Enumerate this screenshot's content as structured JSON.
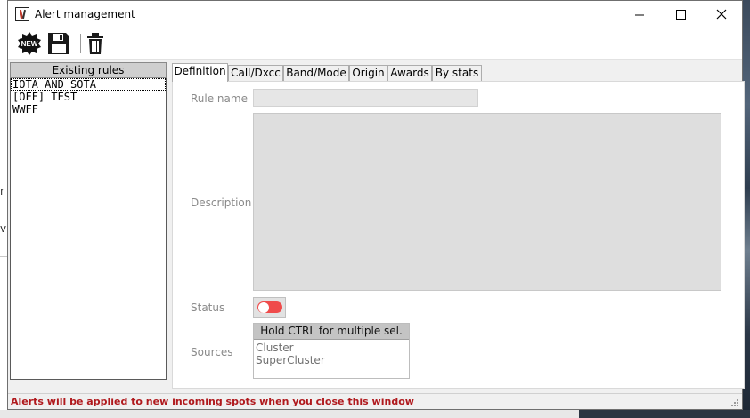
{
  "window": {
    "title": "Alert management"
  },
  "toolbar": {
    "new_badge": "NEW",
    "icons": [
      "new-icon",
      "save-floppy-icon",
      "trash-icon"
    ]
  },
  "rules_panel": {
    "header": "Existing rules",
    "items": [
      {
        "label": "IOTA AND SOTA",
        "selected": true
      },
      {
        "label": "[OFF] TEST",
        "selected": false
      },
      {
        "label": "WWFF",
        "selected": false
      }
    ]
  },
  "tabs": [
    {
      "label": "Definition",
      "active": true
    },
    {
      "label": "Call/Dxcc",
      "active": false
    },
    {
      "label": "Band/Mode",
      "active": false
    },
    {
      "label": "Origin",
      "active": false
    },
    {
      "label": "Awards",
      "active": false
    },
    {
      "label": "By stats",
      "active": false
    }
  ],
  "definition": {
    "rule_name_label": "Rule name",
    "rule_name_value": "",
    "description_label": "Description",
    "description_value": "",
    "status_label": "Status",
    "status_on": false,
    "sources_label": "Sources",
    "sources_hint": "Hold CTRL for multiple sel.",
    "sources": [
      "Cluster",
      "SuperCluster"
    ]
  },
  "statusbar": {
    "text": "Alerts will be applied to new incoming spots when you close this window"
  },
  "colors": {
    "status_text": "#b0191d",
    "toggle_off": "#ef4b4b",
    "window_bg": "#f0f0f0"
  }
}
